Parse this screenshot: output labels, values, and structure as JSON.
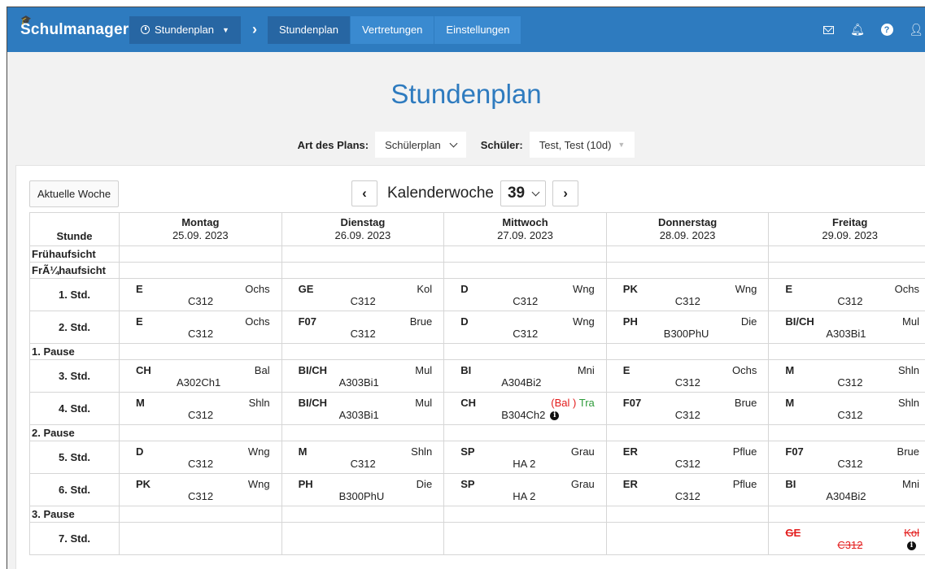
{
  "app": {
    "brand": "Schulmanager"
  },
  "nav": {
    "dropdown_label": "Stundenplan",
    "tabs": [
      {
        "label": "Stundenplan",
        "active": true
      },
      {
        "label": "Vertretungen",
        "active": false
      },
      {
        "label": "Einstellungen",
        "active": false
      }
    ],
    "icons": [
      "envelope-icon",
      "bell-icon",
      "help-icon",
      "user-icon"
    ]
  },
  "page": {
    "title": "Stundenplan",
    "plan_type_label": "Art des Plans:",
    "plan_type_value": "Schülerplan",
    "student_label": "Schüler:",
    "student_value": "Test, Test (10d)"
  },
  "week": {
    "current_week_button": "Aktuelle Woche",
    "label": "Kalenderwoche",
    "number": "39"
  },
  "timetable": {
    "corner_header": "Stunde",
    "days": [
      {
        "name": "Montag",
        "date": "25.09. 2023"
      },
      {
        "name": "Dienstag",
        "date": "26.09. 2023"
      },
      {
        "name": "Mittwoch",
        "date": "27.09. 2023"
      },
      {
        "name": "Donnerstag",
        "date": "28.09. 2023"
      },
      {
        "name": "Freitag",
        "date": "29.09. 2023"
      }
    ],
    "rows": [
      {
        "label": "Frühaufsicht",
        "type": "break"
      },
      {
        "label": "FrÃ¼haufsicht",
        "type": "break"
      },
      {
        "label": "1. Std.",
        "type": "lesson",
        "cells": [
          {
            "subject": "E",
            "room": "C312",
            "teacher": "Ochs"
          },
          {
            "subject": "GE",
            "room": "C312",
            "teacher": "Kol"
          },
          {
            "subject": "D",
            "room": "C312",
            "teacher": "Wng"
          },
          {
            "subject": "PK",
            "room": "C312",
            "teacher": "Wng"
          },
          {
            "subject": "E",
            "room": "C312",
            "teacher": "Ochs"
          }
        ]
      },
      {
        "label": "2. Std.",
        "type": "lesson",
        "cells": [
          {
            "subject": "E",
            "room": "C312",
            "teacher": "Ochs"
          },
          {
            "subject": "F07",
            "room": "C312",
            "teacher": "Brue"
          },
          {
            "subject": "D",
            "room": "C312",
            "teacher": "Wng"
          },
          {
            "subject": "PH",
            "room": "B300PhU",
            "teacher": "Die"
          },
          {
            "subject": "BI/CH",
            "room": "A303Bi1",
            "teacher": "Mul"
          }
        ]
      },
      {
        "label": "1. Pause",
        "type": "break"
      },
      {
        "label": "3. Std.",
        "type": "lesson",
        "cells": [
          {
            "subject": "CH",
            "room": "A302Ch1",
            "teacher": "Bal"
          },
          {
            "subject": "BI/CH",
            "room": "A303Bi1",
            "teacher": "Mul"
          },
          {
            "subject": "BI",
            "room": "A304Bi2",
            "teacher": "Mni"
          },
          {
            "subject": "E",
            "room": "C312",
            "teacher": "Ochs"
          },
          {
            "subject": "M",
            "room": "C312",
            "teacher": "Shln"
          }
        ]
      },
      {
        "label": "4. Std.",
        "type": "lesson",
        "cells": [
          {
            "subject": "M",
            "room": "C312",
            "teacher": "Shln"
          },
          {
            "subject": "BI/CH",
            "room": "A303Bi1",
            "teacher": "Mul"
          },
          {
            "subject": "CH",
            "room": "B304Ch2",
            "teacher_old": "(Bal )",
            "teacher_new": "Tra",
            "substitution": true
          },
          {
            "subject": "F07",
            "room": "C312",
            "teacher": "Brue"
          },
          {
            "subject": "M",
            "room": "C312",
            "teacher": "Shln"
          }
        ]
      },
      {
        "label": "2. Pause",
        "type": "break"
      },
      {
        "label": "5. Std.",
        "type": "lesson",
        "cells": [
          {
            "subject": "D",
            "room": "C312",
            "teacher": "Wng"
          },
          {
            "subject": "M",
            "room": "C312",
            "teacher": "Shln"
          },
          {
            "subject": "SP",
            "room": "HA 2",
            "teacher": "Grau"
          },
          {
            "subject": "ER",
            "room": "C312",
            "teacher": "Pflue"
          },
          {
            "subject": "F07",
            "room": "C312",
            "teacher": "Brue"
          }
        ]
      },
      {
        "label": "6. Std.",
        "type": "lesson",
        "cells": [
          {
            "subject": "PK",
            "room": "C312",
            "teacher": "Wng"
          },
          {
            "subject": "PH",
            "room": "B300PhU",
            "teacher": "Die"
          },
          {
            "subject": "SP",
            "room": "HA 2",
            "teacher": "Grau"
          },
          {
            "subject": "ER",
            "room": "C312",
            "teacher": "Pflue"
          },
          {
            "subject": "BI",
            "room": "A304Bi2",
            "teacher": "Mni"
          }
        ]
      },
      {
        "label": "3. Pause",
        "type": "break"
      },
      {
        "label": "7. Std.",
        "type": "lesson",
        "cells": [
          {},
          {},
          {},
          {},
          {
            "subject": "GE",
            "room": "C312",
            "teacher": "Kol",
            "cancelled": true
          }
        ]
      }
    ]
  },
  "colors": {
    "navbar": "#2e7bbf",
    "title": "#2e7bbf",
    "cancelled": "#e31b1b",
    "substitute": "#2e9b3a"
  }
}
